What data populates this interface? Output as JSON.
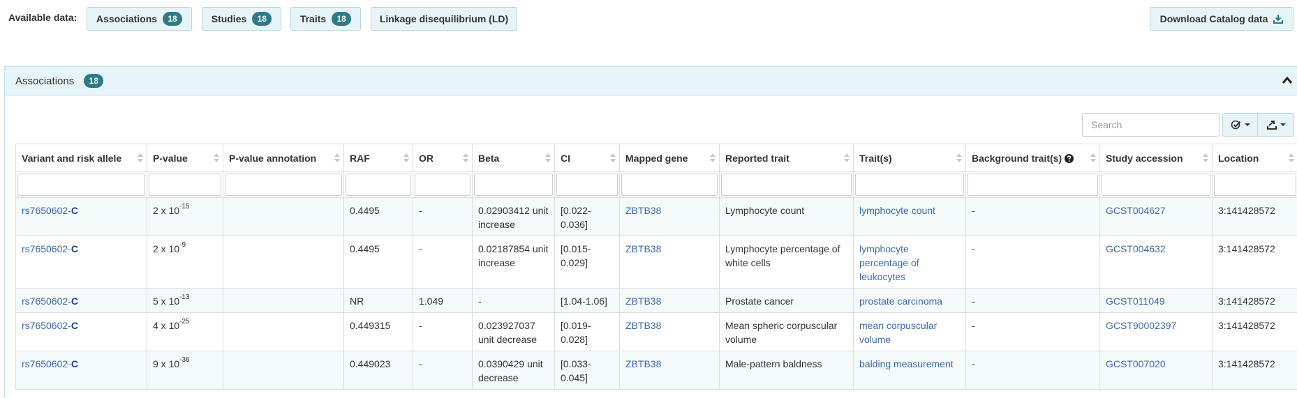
{
  "top": {
    "available_label": "Available data:",
    "buttons": [
      {
        "label": "Associations",
        "count": "18"
      },
      {
        "label": "Studies",
        "count": "18"
      },
      {
        "label": "Traits",
        "count": "18"
      },
      {
        "label": "Linkage disequilibrium (LD)"
      }
    ],
    "download_label": "Download Catalog data",
    "download_icon": "download-icon"
  },
  "panel": {
    "title": "Associations",
    "count": "18",
    "collapse_icon": "chevron-up-icon",
    "search_placeholder": "Search"
  },
  "table": {
    "headers": [
      "Variant and risk allele",
      "P-value",
      "P-value annotation",
      "RAF",
      "OR",
      "Beta",
      "CI",
      "Mapped gene",
      "Reported trait",
      "Trait(s)",
      "Background trait(s)",
      "Study accession",
      "Location"
    ],
    "rows": [
      {
        "variant": "rs7650602-",
        "allele": "C",
        "p_mant": "2 x 10",
        "p_exp": "-15",
        "p_annot": "",
        "raf": "0.4495",
        "or": "-",
        "beta": "0.02903412 unit increase",
        "ci": "[0.022-0.036]",
        "gene": "ZBTB38",
        "reported": "Lymphocyte count",
        "traits": "lymphocyte count",
        "background": "-",
        "study": "GCST004627",
        "location": "3:141428572"
      },
      {
        "variant": "rs7650602-",
        "allele": "C",
        "p_mant": "2 x 10",
        "p_exp": "-9",
        "p_annot": "",
        "raf": "0.4495",
        "or": "-",
        "beta": "0.02187854 unit increase",
        "ci": "[0.015-0.029]",
        "gene": "ZBTB38",
        "reported": "Lymphocyte percentage of white cells",
        "traits": "lymphocyte percentage of leukocytes",
        "background": "-",
        "study": "GCST004632",
        "location": "3:141428572"
      },
      {
        "variant": "rs7650602-",
        "allele": "C",
        "p_mant": "5 x 10",
        "p_exp": "-13",
        "p_annot": "",
        "raf": "NR",
        "or": "1.049",
        "beta": "-",
        "ci": "[1.04-1.06]",
        "gene": "ZBTB38",
        "reported": "Prostate cancer",
        "traits": "prostate carcinoma",
        "background": "-",
        "study": "GCST011049",
        "location": "3:141428572"
      },
      {
        "variant": "rs7650602-",
        "allele": "C",
        "p_mant": "4 x 10",
        "p_exp": "-25",
        "p_annot": "",
        "raf": "0.449315",
        "or": "-",
        "beta": "0.023927037 unit decrease",
        "ci": "[0.019-0.028]",
        "gene": "ZBTB38",
        "reported": "Mean spheric corpuscular volume",
        "traits": "mean corpuscular volume",
        "background": "-",
        "study": "GCST90002397",
        "location": "3:141428572"
      },
      {
        "variant": "rs7650602-",
        "allele": "C",
        "p_mant": "9 x 10",
        "p_exp": "-36",
        "p_annot": "",
        "raf": "0.449023",
        "or": "-",
        "beta": "0.0390429 unit decrease",
        "ci": "[0.033-0.045]",
        "gene": "ZBTB38",
        "reported": "Male-pattern baldness",
        "traits": "balding measurement",
        "background": "-",
        "study": "GCST007020",
        "location": "3:141428572"
      }
    ]
  },
  "colors": {
    "accent": "#2d7b85",
    "panel_bg": "#e6f4f7",
    "link": "#3c6aa6"
  }
}
